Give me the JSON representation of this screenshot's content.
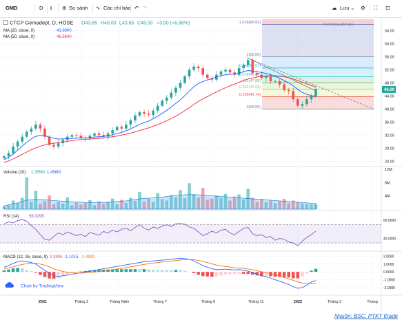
{
  "toolbar": {
    "symbol": "GMD",
    "interval": "D",
    "compare_label": "So sánh",
    "indicators_label": "Các chỉ báo",
    "save_label": "Lưu"
  },
  "legend": {
    "title": "CTCP Gemadept, D, HOSE",
    "open": "O43.85",
    "high": "H46.00",
    "low": "L43.85",
    "close": "C46.00",
    "change": "+3.00 (+6.98%)",
    "ma20_label": "MA (20, close, 0)",
    "ma20_value": "43.8900",
    "ma50_label": "MA (50, close, 0)",
    "ma50_value": "46.6640",
    "volume_label": "Volume (20)",
    "volume_v1": "1.359M",
    "volume_v2": "1.458M",
    "rsi_label": "RSI (14)",
    "rsi_value": "56.0295",
    "macd_label": "MACD (12, 26, close, 9)",
    "macd_v1": "0.3905",
    "macd_v2": "-1.1015",
    "macd_v3": "-1.4920",
    "tv_link": "Chart by TradingView",
    "trend_note": "Thị trường giảm giá"
  },
  "colors": {
    "up": "#26a69a",
    "down": "#ef5350",
    "ma20": "#2962ff",
    "ma50": "#f23645",
    "rsi": "#7e57c2",
    "macd": "#2962ff",
    "signal": "#ff6d00",
    "price_tag": "#26a69a"
  },
  "chart_data": [
    {
      "type": "candlestick",
      "title": "CTCP Gemadept, D, HOSE",
      "x_ticks": [
        "2021",
        "Tháng 3",
        "Tháng Năm",
        "Tháng 7",
        "Tháng 9",
        "Tháng 11",
        "2022",
        "Tháng 3",
        "Tháng"
      ],
      "ylim": [
        23,
        67.5
      ],
      "y_ticks": [
        "24.00",
        "28.00",
        "32.00",
        "36.00",
        "40.00",
        "44.00",
        "48.00",
        "52.00",
        "56.00",
        "60.00",
        "64.00"
      ],
      "last_price": "46.00",
      "close_series": [
        25.5,
        26.5,
        28.5,
        30,
        31.5,
        33,
        34,
        35.2,
        34,
        31.5,
        29,
        28.5,
        29.5,
        30.5,
        31.5,
        32,
        31.8,
        31.2,
        31,
        31.8,
        32.5,
        32,
        31.5,
        32.5,
        33.5,
        34.5,
        34,
        35.2,
        36.5,
        38,
        39,
        38.5,
        38.2,
        39.5,
        41,
        42.5,
        43.5,
        45,
        46.5,
        48,
        50,
        52,
        53,
        52.5,
        50.5,
        49.5,
        49,
        50.5,
        51.5,
        52,
        51.2,
        50.5,
        52.5,
        53.5,
        55,
        51,
        50.5,
        49.5,
        50,
        48.5,
        48.5,
        47.5,
        45.8,
        45.5,
        43,
        41,
        41.5,
        43,
        44,
        46
      ],
      "ma20": [
        24.5,
        25.2,
        26.2,
        27.4,
        28.6,
        29.8,
        30.8,
        31.6,
        31.9,
        31.8,
        31.4,
        31,
        30.8,
        30.8,
        30.9,
        31,
        31.1,
        31.1,
        31.1,
        31.2,
        31.4,
        31.5,
        31.6,
        31.8,
        32.1,
        32.5,
        32.8,
        33.3,
        33.9,
        34.6,
        35.3,
        35.8,
        36.3,
        37,
        37.8,
        38.7,
        39.6,
        40.6,
        41.7,
        42.8,
        44.1,
        45.5,
        46.8,
        47.8,
        48.4,
        48.9,
        49.3,
        49.8,
        50.2,
        50.5,
        50.6,
        50.7,
        51,
        51.4,
        51.8,
        51.6,
        51.4,
        51.2,
        50.9,
        50.5,
        50,
        49.4,
        48.7,
        48,
        47.1,
        46,
        45.1,
        44.5,
        44.1,
        43.9
      ],
      "ma50": [
        23.6,
        24.1,
        24.7,
        25.4,
        26.1,
        26.8,
        27.5,
        28.1,
        28.6,
        29,
        29.3,
        29.5,
        29.7,
        29.9,
        30.1,
        30.3,
        30.5,
        30.6,
        30.7,
        30.8,
        30.9,
        31,
        31.1,
        31.3,
        31.5,
        31.7,
        32,
        32.3,
        32.6,
        33,
        33.4,
        33.8,
        34.2,
        34.7,
        35.2,
        35.8,
        36.4,
        37.1,
        37.8,
        38.6,
        39.5,
        40.4,
        41.4,
        42.3,
        43.1,
        43.8,
        44.5,
        45.2,
        45.9,
        46.5,
        47.1,
        47.6,
        48.2,
        48.7,
        49.2,
        49.5,
        49.8,
        50,
        50.1,
        50.2,
        50.2,
        50.1,
        49.9,
        49.6,
        49.2,
        48.7,
        48.2,
        47.7,
        47.2,
        46.7
      ]
    },
    {
      "type": "table",
      "title": "Fibonacci Retracement",
      "levels": [
        {
          "label": "1.618(65.92)",
          "price": 65.92
        },
        {
          "label": "1(56.00)",
          "price": 56
        },
        {
          "label": "0.786(52.57)",
          "price": 52.57
        },
        {
          "label": "0.618(49.87)",
          "price": 49.87
        },
        {
          "label": "0.5(47.98)",
          "price": 47.98
        },
        {
          "label": "0.382(46.08)",
          "price": 46.08
        },
        {
          "label": "0.236(43.74)",
          "price": 43.74
        },
        {
          "label": "0(39.95)",
          "price": 39.95
        }
      ]
    },
    {
      "type": "bar",
      "title": "Volume (20)",
      "ylim": [
        0,
        12
      ],
      "y_ticks": [
        "4M",
        "8M",
        "12M"
      ],
      "values": [
        0.8,
        1.2,
        2.6,
        1.9,
        3.4,
        9.6,
        2.2,
        5.5,
        1.6,
        2.4,
        4.1,
        1.5,
        2.2,
        1.7,
        3.6,
        1.2,
        2,
        1.4,
        1.8,
        2.7,
        1.2,
        2.4,
        1.6,
        2.2,
        3.2,
        1.5,
        2.8,
        1.9,
        3.4,
        2.5,
        5.2,
        2.3,
        3.1,
        2.2,
        4.8,
        3,
        2.6,
        4.2,
        3.6,
        5.7,
        3.3,
        7.8,
        4.4,
        3.5,
        6.4,
        2.8,
        3.2,
        4.1,
        3.3,
        4.6,
        2.6,
        3.8,
        4.4,
        2.9,
        6.1,
        3.4,
        2.2,
        3.1,
        2.1,
        2.6,
        1.8,
        2.4,
        3.1,
        1.8,
        2.6,
        2.1,
        1.7,
        1.6,
        1.4,
        1.4
      ],
      "volume_ma": [
        1,
        1.3,
        1.6,
        1.9,
        2.3,
        2.7,
        2.8,
        2.9,
        2.9,
        2.8,
        2.7,
        2.6,
        2.5,
        2.4,
        2.3,
        2.2,
        2.1,
        2.1,
        2,
        2,
        2,
        2,
        2,
        2.1,
        2.2,
        2.3,
        2.4,
        2.5,
        2.7,
        2.9,
        3.1,
        3.2,
        3.3,
        3.4,
        3.5,
        3.6,
        3.8,
        4,
        4.1,
        4.2,
        4.3,
        4.4,
        4.4,
        4.3,
        4.2,
        4.1,
        4,
        3.9,
        3.8,
        3.7,
        3.6,
        3.5,
        3.4,
        3.3,
        3.2,
        3.1,
        3,
        2.9,
        2.8,
        2.7,
        2.6,
        2.5,
        2.4,
        2.3,
        2.2,
        2.1,
        2,
        1.9,
        1.8,
        1.7
      ]
    },
    {
      "type": "line",
      "title": "RSI (14)",
      "ylim": [
        15,
        95
      ],
      "y_ticks": [
        "80.0000",
        "40.0000"
      ],
      "band": [
        30,
        70
      ],
      "values": [
        72,
        76,
        74,
        79,
        81,
        78,
        68,
        60,
        48,
        38,
        36,
        44,
        52,
        48,
        54,
        50,
        46,
        49,
        44,
        53,
        50,
        47,
        55,
        52,
        58,
        54,
        60,
        62,
        57,
        64,
        70,
        62,
        58,
        65,
        62,
        67,
        70,
        66,
        72,
        73,
        71,
        65,
        62,
        54,
        46,
        50,
        56,
        52,
        58,
        60,
        52,
        48,
        55,
        62,
        64,
        50,
        46,
        48,
        42,
        44,
        36,
        40,
        38,
        32,
        30,
        24,
        34,
        42,
        48,
        56
      ]
    },
    {
      "type": "line",
      "title": "MACD (12, 26, close, 9)",
      "ylim": [
        -2.8,
        2.3
      ],
      "y_ticks": [
        "2.0000",
        "1.0000",
        "0.0000",
        "-1.0000",
        "-2.0000"
      ],
      "macd": [
        0.6,
        0.8,
        1.1,
        1.3,
        1.4,
        1.3,
        1.2,
        1,
        0.6,
        0.2,
        -0.2,
        -0.5,
        -0.6,
        -0.5,
        -0.4,
        -0.3,
        -0.2,
        -0.1,
        0,
        0.1,
        0.2,
        0.3,
        0.4,
        0.5,
        0.6,
        0.7,
        0.8,
        0.9,
        1,
        1.1,
        1.2,
        1.3,
        1.35,
        1.4,
        1.45,
        1.5,
        1.55,
        1.6,
        1.7,
        1.75,
        1.7,
        1.6,
        1.4,
        1.1,
        0.8,
        0.6,
        0.4,
        0.3,
        0.3,
        0.35,
        0.3,
        0.25,
        0.3,
        0.2,
        0.1,
        -0.1,
        -0.3,
        -0.5,
        -0.6,
        -0.8,
        -1,
        -1.2,
        -1.4,
        -1.6,
        -1.9,
        -2.1,
        -2,
        -1.7,
        -1.3,
        -1.1
      ],
      "signal": [
        0.4,
        0.5,
        0.65,
        0.8,
        0.95,
        1.05,
        1.1,
        1.1,
        1,
        0.85,
        0.65,
        0.4,
        0.2,
        0.05,
        -0.05,
        -0.12,
        -0.15,
        -0.15,
        -0.12,
        -0.08,
        -0.02,
        0.05,
        0.12,
        0.2,
        0.28,
        0.37,
        0.46,
        0.55,
        0.65,
        0.75,
        0.85,
        0.95,
        1.05,
        1.12,
        1.2,
        1.26,
        1.32,
        1.38,
        1.45,
        1.52,
        1.57,
        1.59,
        1.56,
        1.47,
        1.34,
        1.19,
        1.03,
        0.88,
        0.77,
        0.69,
        0.61,
        0.54,
        0.5,
        0.44,
        0.37,
        0.27,
        0.15,
        0.02,
        -0.1,
        -0.24,
        -0.39,
        -0.55,
        -0.72,
        -0.89,
        -1.08,
        -1.28,
        -1.42,
        -1.48,
        -1.45,
        -1.49
      ]
    }
  ],
  "source": "Nguồn: BSC, PTKT Itrade"
}
